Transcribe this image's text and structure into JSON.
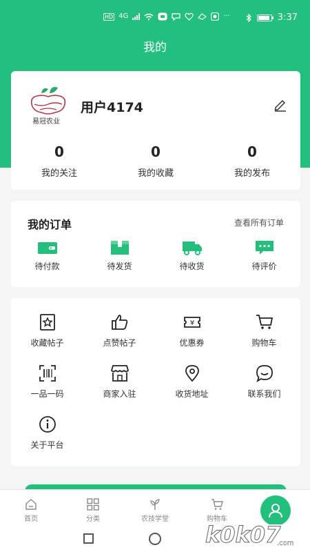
{
  "status_bar": {
    "hd": "HD",
    "network": "4G",
    "time": "3:37"
  },
  "page_title": "我的",
  "profile": {
    "logo_text": "易冠农业",
    "username": "用户4174",
    "stats": [
      {
        "value": "0",
        "label": "我的关注"
      },
      {
        "value": "0",
        "label": "我的收藏"
      },
      {
        "value": "0",
        "label": "我的发布"
      }
    ]
  },
  "orders": {
    "title": "我的订单",
    "view_all": "查看所有订单",
    "items": [
      {
        "label": "待付款",
        "icon": "wallet-icon"
      },
      {
        "label": "待发货",
        "icon": "box-icon"
      },
      {
        "label": "待收货",
        "icon": "truck-icon"
      },
      {
        "label": "待评价",
        "icon": "comment-icon"
      }
    ]
  },
  "tools": {
    "items": [
      {
        "label": "收藏帖子",
        "icon": "star-icon"
      },
      {
        "label": "点赞帖子",
        "icon": "thumb-up-icon"
      },
      {
        "label": "优惠券",
        "icon": "coupon-icon"
      },
      {
        "label": "购物车",
        "icon": "cart-icon"
      },
      {
        "label": "一品一码",
        "icon": "scan-icon"
      },
      {
        "label": "商家入驻",
        "icon": "shop-icon"
      },
      {
        "label": "收货地址",
        "icon": "location-icon"
      },
      {
        "label": "联系我们",
        "icon": "chat-icon"
      },
      {
        "label": "关于平台",
        "icon": "info-icon"
      }
    ]
  },
  "bottom_nav": {
    "items": [
      {
        "label": "首页",
        "icon": "home-icon"
      },
      {
        "label": "分类",
        "icon": "category-icon"
      },
      {
        "label": "农技学堂",
        "icon": "plant-icon"
      },
      {
        "label": "购物车",
        "icon": "cart-icon"
      }
    ],
    "active_icon": "user-icon"
  },
  "watermark": "k0k07.com",
  "colors": {
    "primary": "#22c07c",
    "background": "#f5f5f5",
    "text": "#222222"
  }
}
